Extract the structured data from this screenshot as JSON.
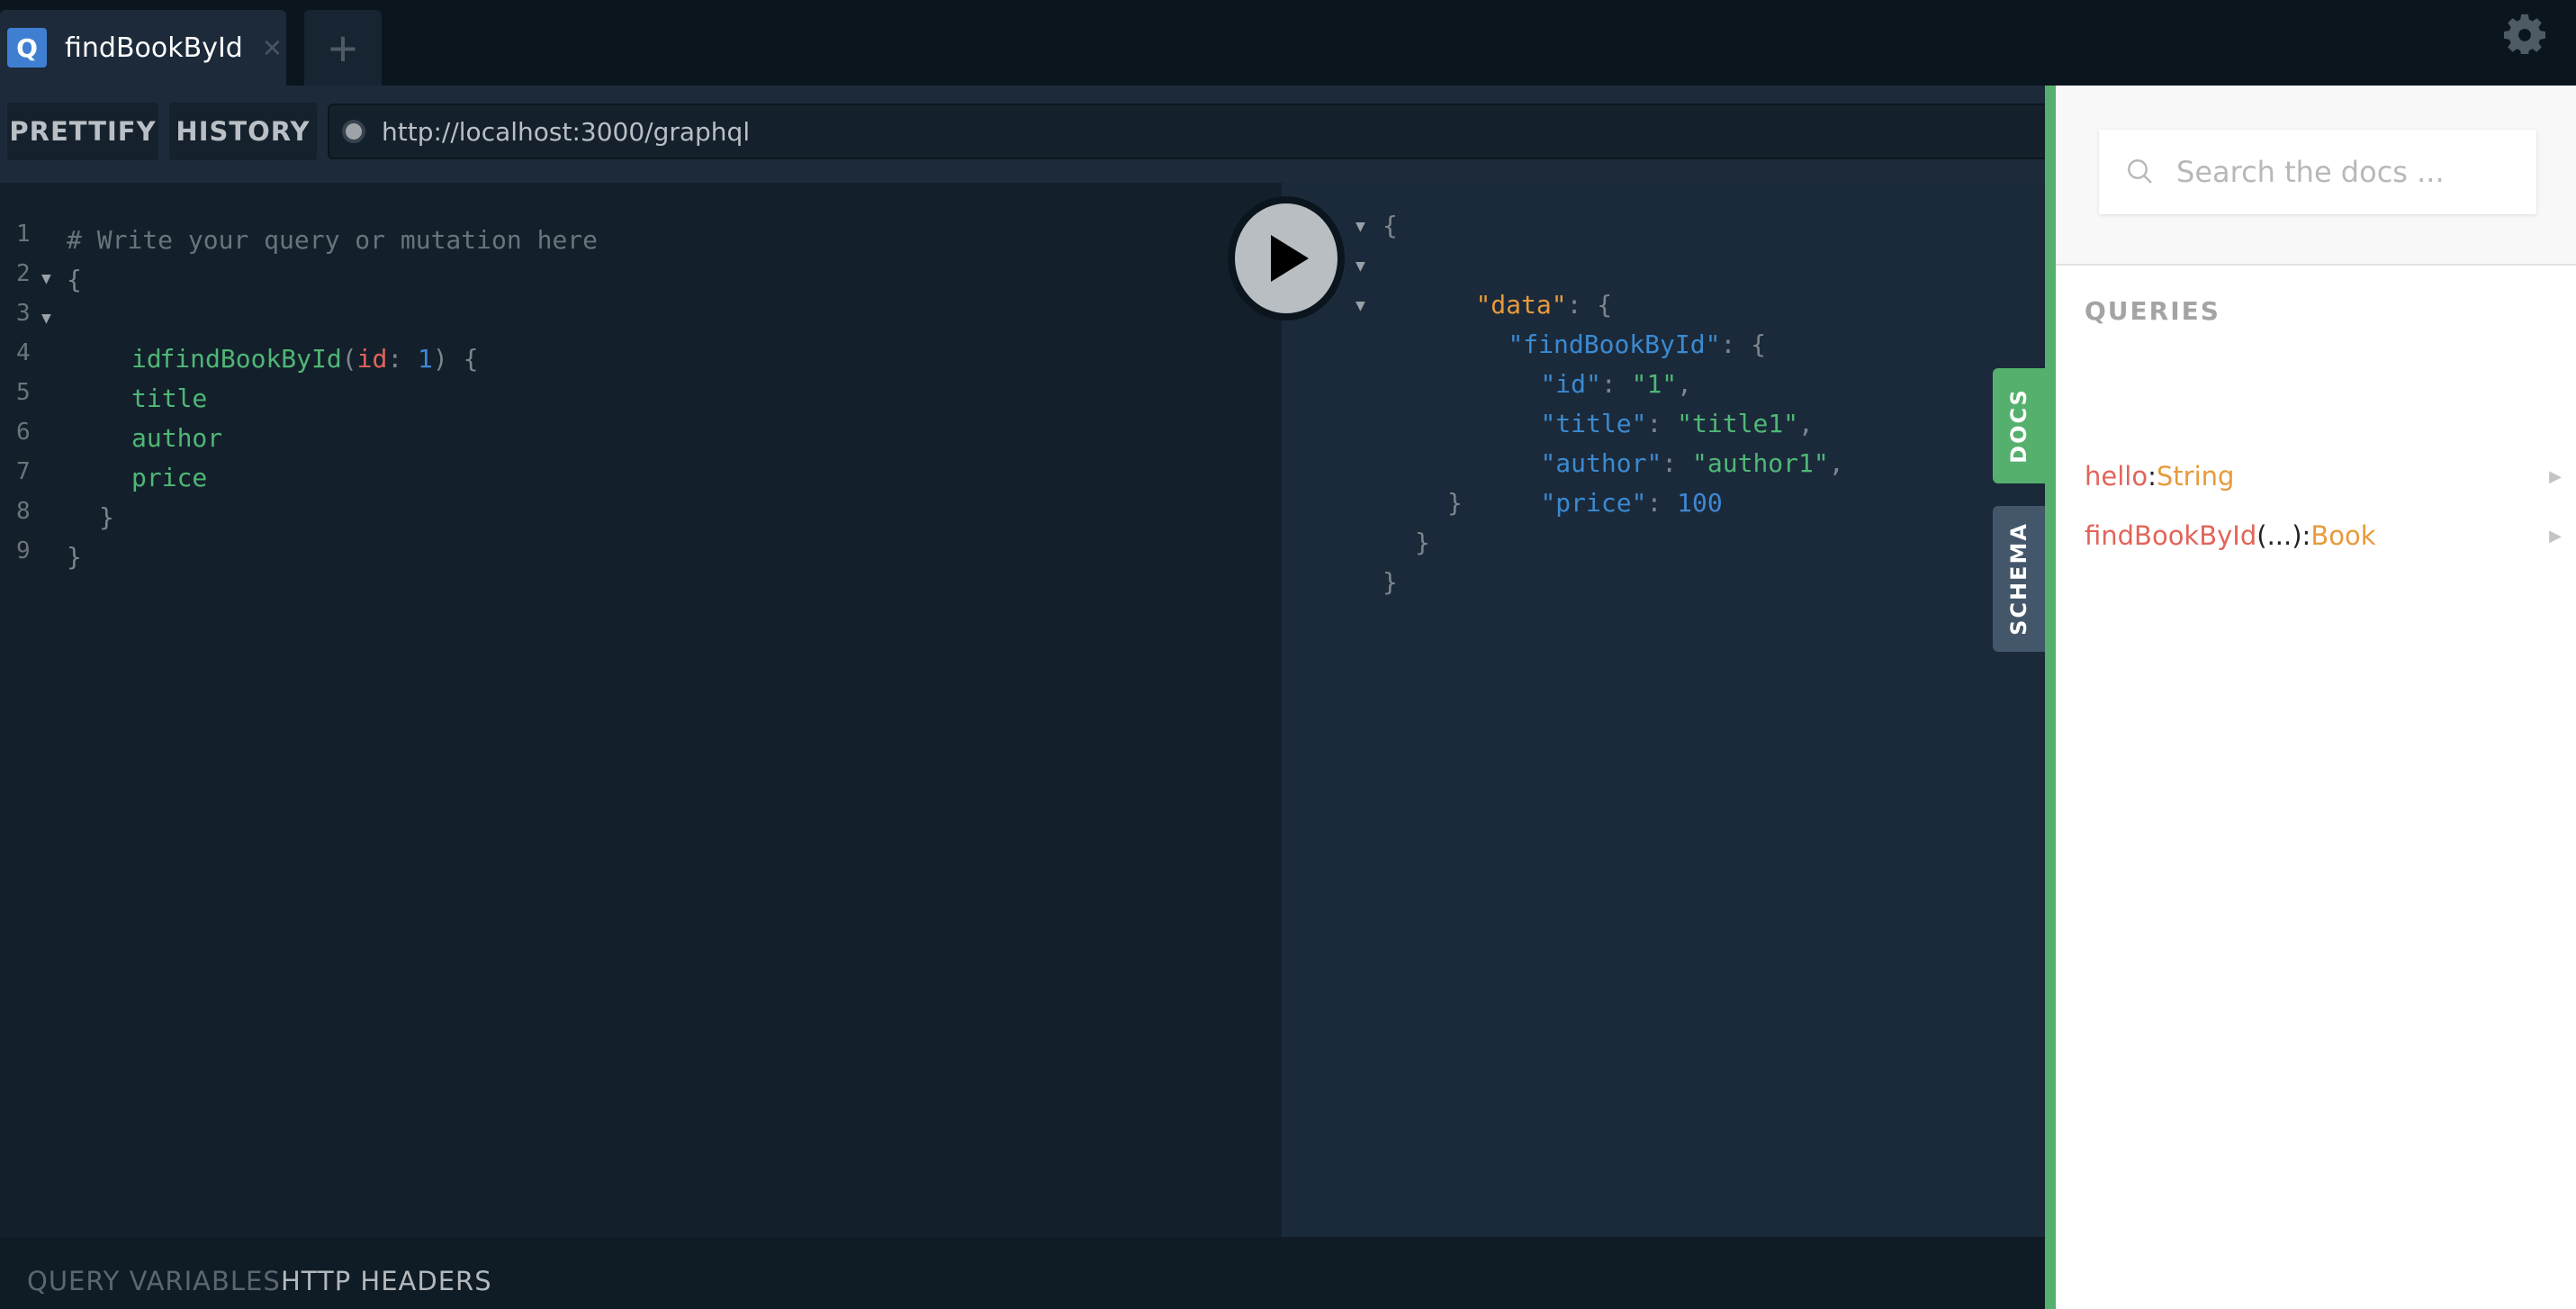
{
  "tabs": [
    {
      "badge": "Q",
      "title": "findBookById",
      "close_icon": "×"
    }
  ],
  "tab_add_label": "+",
  "toolbar": {
    "prettify_label": "PRETTIFY",
    "history_label": "HISTORY",
    "endpoint_url": "http://localhost:3000/graphql"
  },
  "editor": {
    "line_numbers": [
      "1",
      "2",
      "3",
      "4",
      "5",
      "6",
      "7",
      "8",
      "9"
    ],
    "comment": "# Write your query or mutation here",
    "open_brace": "{",
    "query_name": "findBookById",
    "paren_open": "(",
    "arg_name": "id",
    "arg_colon": ": ",
    "arg_value": "1",
    "paren_close_brace": ") {",
    "fields": [
      "id",
      "title",
      "author",
      "price"
    ],
    "inner_close": "}",
    "outer_close": "}"
  },
  "result": {
    "open_brace": "{",
    "data_key": "\"data\"",
    "colon_brace": ": {",
    "query_key": "\"findBookById\"",
    "fields": [
      {
        "key": "\"id\"",
        "value": "\"1\"",
        "type": "string",
        "suffix": ","
      },
      {
        "key": "\"title\"",
        "value": "\"title1\"",
        "type": "string",
        "suffix": ","
      },
      {
        "key": "\"author\"",
        "value": "\"author1\"",
        "type": "string",
        "suffix": ","
      },
      {
        "key": "\"price\"",
        "value": "100",
        "type": "number",
        "suffix": ""
      }
    ],
    "close_brace": "}",
    "colon": ": "
  },
  "bottom_tabs": {
    "query_variables": "QUERY VARIABLES",
    "http_headers": "HTTP HEADERS"
  },
  "side_tabs": {
    "docs": "DOCS",
    "schema": "SCHEMA"
  },
  "docs": {
    "search_placeholder": "Search the docs ...",
    "section_title": "QUERIES",
    "items": [
      {
        "name": "hello",
        "args": "",
        "colon": ": ",
        "type": "String"
      },
      {
        "name": "findBookById",
        "args": "(...)",
        "colon": ": ",
        "type": "Book"
      }
    ]
  },
  "icons": {
    "settings": "gear-icon",
    "run": "play-icon",
    "search": "search-icon",
    "fold": "triangle-down-icon",
    "expand": "triangle-right-icon"
  },
  "colors": {
    "accent_green": "#55b06d",
    "tab_badge_blue": "#3e7fd2",
    "field_green": "#4fb776",
    "arg_red": "#e2645a",
    "type_orange": "#e89a3c",
    "number_blue": "#3f87d6"
  }
}
